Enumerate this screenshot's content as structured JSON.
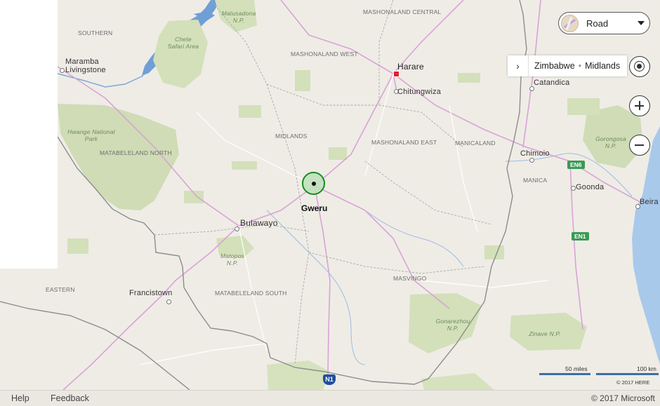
{
  "map": {
    "style_selector": {
      "label": "Road"
    },
    "breadcrumb": {
      "country": "Zimbabwe",
      "region": "Midlands"
    },
    "selected_place": {
      "name": "Gweru"
    },
    "regions": [
      "SOUTHERN",
      "MASHONALAND CENTRAL",
      "MASHONALAND WEST",
      "MIDLANDS",
      "MASHONALAND EAST",
      "MANICALAND",
      "MATABELELAND NORTH",
      "MATABELELAND SOUTH",
      "MASVINGO",
      "MANICA",
      "EASTERN"
    ],
    "cities": [
      "Maramba Livingstone",
      "Harare",
      "Chitungwiza",
      "Catandica",
      "Chimoio",
      "Goonda",
      "Beira",
      "Bulawayo",
      "Francistown"
    ],
    "parks": [
      "Matusadona N.P.",
      "Chete Safari Area",
      "Hwange National Park",
      "Gorongosa N.P.",
      "Matopos N.P.",
      "Gonarezhou N.P.",
      "Zinave N.P."
    ],
    "road_shields": [
      "EN6",
      "EN1",
      "N1"
    ],
    "scale": {
      "miles": "50 miles",
      "km": "100 km"
    },
    "map_copyright": "© 2017 HERE"
  },
  "footer": {
    "help": "Help",
    "feedback": "Feedback",
    "copyright": "© 2017 Microsoft"
  }
}
